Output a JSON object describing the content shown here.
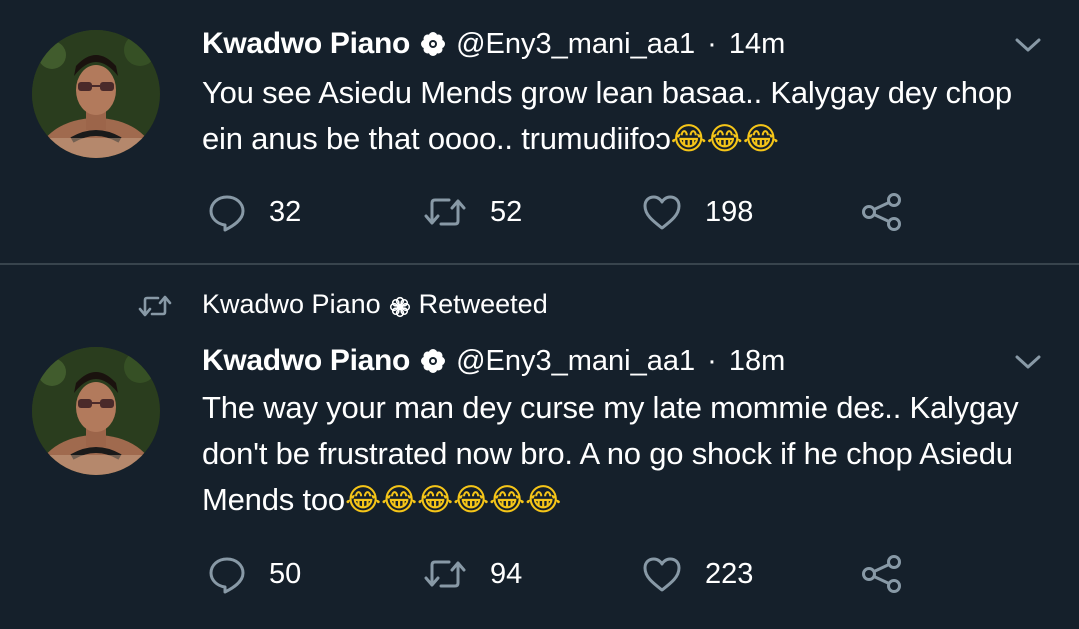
{
  "tweets": [
    {
      "display_name": "Kwadwo Piano",
      "handle": "@Eny3_mani_aa1",
      "dot": "·",
      "time": "14m",
      "text": "You see Asiedu Mends grow lean basaa.. Kalygay dey chop ein anus be that oooo.. trumudiifoɔ",
      "emojis": "😂😂😂",
      "replies": "32",
      "retweets": "52",
      "likes": "198"
    },
    {
      "retweet_context": {
        "name": "Kwadwo Piano",
        "label": "Retweeted"
      },
      "display_name": "Kwadwo Piano",
      "handle": "@Eny3_mani_aa1",
      "dot": "·",
      "time": "18m",
      "text": "The way your man dey curse my late mommie deɛ.. Kalygay don't be frustrated now bro. A no go shock if he chop Asiedu Mends too",
      "emojis": "😂😂😂😂😂😂",
      "replies": "50",
      "retweets": "94",
      "likes": "223"
    }
  ],
  "colors": {
    "background": "#15202b",
    "divider": "#38444d",
    "text": "#ffffff",
    "icon": "#8899a6"
  },
  "icons": {
    "verified": "flower-badge-icon",
    "caret": "chevron-down-icon",
    "reply": "speech-bubble-icon",
    "retweet": "retweet-arrows-icon",
    "like": "heart-outline-icon",
    "share": "share-nodes-icon"
  }
}
